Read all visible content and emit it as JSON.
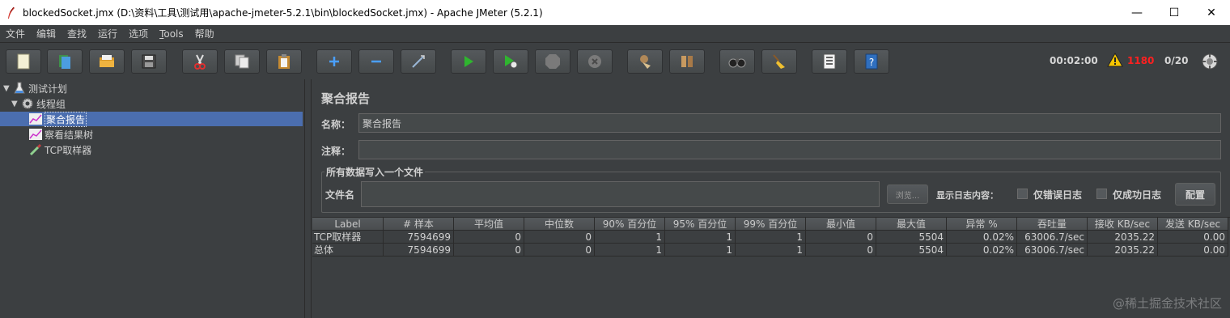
{
  "window": {
    "title": "blockedSocket.jmx (D:\\资料\\工具\\测试用\\apache-jmeter-5.2.1\\bin\\blockedSocket.jmx) - Apache JMeter (5.2.1)",
    "minimize": "—",
    "maximize": "☐",
    "close": "✕"
  },
  "menu": [
    "文件",
    "编辑",
    "查找",
    "运行",
    "选项",
    "Tools",
    "帮助"
  ],
  "toolbar": {
    "timer": "00:02:00",
    "error_count": "1180",
    "threads": "0/20",
    "error_color": "#ff2020"
  },
  "tree": {
    "items": [
      {
        "label": "测试计划",
        "icon": "flask-icon"
      },
      {
        "label": "线程组",
        "icon": "gear-icon"
      },
      {
        "label": "聚合报告",
        "icon": "chart-icon"
      },
      {
        "label": "察看结果树",
        "icon": "chart-icon"
      },
      {
        "label": "TCP取样器",
        "icon": "pipette-icon"
      }
    ]
  },
  "panel": {
    "title": "聚合报告",
    "name_label": "名称：",
    "name_value": "聚合报告",
    "comment_label": "注释：",
    "comment_value": "",
    "file_section_label": "所有数据写入一个文件",
    "filename_label": "文件名",
    "browse_label": "浏览...",
    "log_content_label": "显示日志内容：",
    "errors_only_label": "仅错误日志",
    "success_only_label": "仅成功日志",
    "config_label": "配置"
  },
  "table": {
    "columns": [
      "Label",
      "# 样本",
      "平均值",
      "中位数",
      "90% 百分位",
      "95% 百分位",
      "99% 百分位",
      "最小值",
      "最大值",
      "异常 %",
      "吞吐量",
      "接收 KB/sec",
      "发送 KB/sec"
    ],
    "rows": [
      [
        "TCP取样器",
        "7594699",
        "0",
        "0",
        "1",
        "1",
        "1",
        "0",
        "5504",
        "0.02%",
        "63006.7/sec",
        "2035.22",
        "0.00"
      ],
      [
        "总体",
        "7594699",
        "0",
        "0",
        "1",
        "1",
        "1",
        "0",
        "5504",
        "0.02%",
        "63006.7/sec",
        "2035.22",
        "0.00"
      ]
    ]
  },
  "watermark": "@稀土掘金技术社区"
}
